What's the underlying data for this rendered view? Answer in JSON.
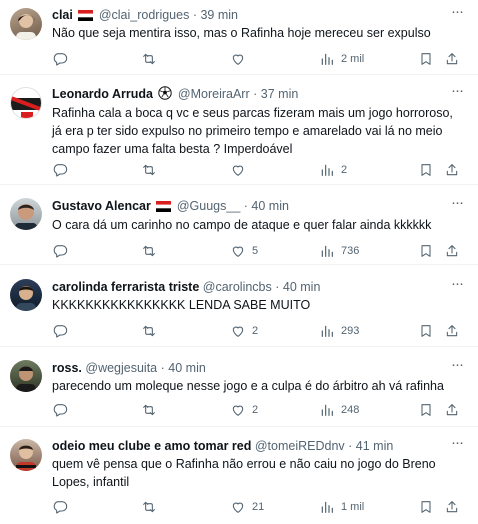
{
  "tweets": [
    {
      "name": "clai",
      "flag": "Brazil Rio",
      "handle": "@clai_rodrigues",
      "sep": "·",
      "time": "39 min",
      "text": "Não que seja mentira isso, mas o Rafinha hoje mereceu ser expulso",
      "replies": "",
      "retweets": "",
      "likes": "",
      "views": "2 mil"
    },
    {
      "name": "Leonardo Arruda",
      "handle": "@MoreiraArr",
      "sep": "·",
      "time": "37 min",
      "text": "Rafinha cala a boca q vc e seus parcas fizeram mais um jogo horroroso, já era p ter sido expulso no primeiro tempo e amarelado vai lá no meio campo fazer uma falta besta ? Imperdoável",
      "replies": "",
      "retweets": "",
      "likes": "",
      "views": "2"
    },
    {
      "name": "Gustavo Alencar",
      "handle": "@Guugs__",
      "sep": "·",
      "time": "40 min",
      "text": "O cara dá um carinho no campo de ataque e quer falar ainda kkkkkk",
      "replies": "",
      "retweets": "",
      "likes": "5",
      "views": "736"
    },
    {
      "name": "carolinda ferrarista triste",
      "handle": "@carolincbs",
      "sep": "·",
      "time": "40 min",
      "text": "KKKKKKKKKKKKKKKK LENDA SABE MUITO",
      "replies": "",
      "retweets": "",
      "likes": "2",
      "views": "293"
    },
    {
      "name": "ross.",
      "handle": "@wegjesuita",
      "sep": "·",
      "time": "40 min",
      "text": "parecendo um moleque nesse jogo e a culpa é do árbitro ah vá rafinha",
      "replies": "",
      "retweets": "",
      "likes": "2",
      "views": "248"
    },
    {
      "name": "odeio meu clube e amo tomar red",
      "handle": "@tomeiREDdnv",
      "sep": "·",
      "time": "41 min",
      "text": "quem vê pensa que o Rafinha não errou e não caiu no jogo do Breno Lopes, infantil",
      "replies": "",
      "retweets": "",
      "likes": "21",
      "views": "1 mil"
    }
  ],
  "colors": {
    "text": "#0f1419",
    "secondary": "#536471",
    "divider": "#eff3f4",
    "flag_red": "#d81e1e",
    "flag_black": "#000000"
  },
  "icons": [
    "reply-icon",
    "retweet-icon",
    "like-icon",
    "views-icon",
    "bookmark-icon",
    "share-icon",
    "more-icon",
    "flag-icon",
    "soccer-ball-icon"
  ]
}
